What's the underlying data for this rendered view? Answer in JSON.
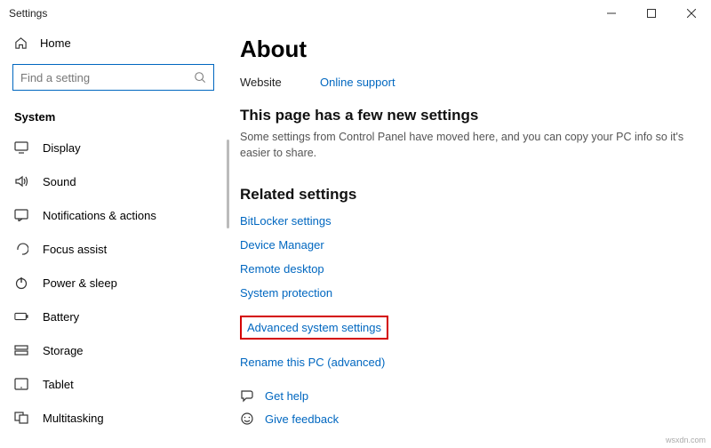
{
  "window": {
    "title": "Settings"
  },
  "sidebar": {
    "home": "Home",
    "search_placeholder": "Find a setting",
    "section": "System",
    "items": [
      {
        "label": "Display"
      },
      {
        "label": "Sound"
      },
      {
        "label": "Notifications & actions"
      },
      {
        "label": "Focus assist"
      },
      {
        "label": "Power & sleep"
      },
      {
        "label": "Battery"
      },
      {
        "label": "Storage"
      },
      {
        "label": "Tablet"
      },
      {
        "label": "Multitasking"
      }
    ]
  },
  "main": {
    "title": "About",
    "website_label": "Website",
    "website_link": "Online support",
    "new_settings_head": "This page has a few new settings",
    "new_settings_desc": "Some settings from Control Panel have moved here, and you can copy your PC info so it's easier to share.",
    "related_head": "Related settings",
    "links": {
      "bitlocker": "BitLocker settings",
      "devmgr": "Device Manager",
      "remote": "Remote desktop",
      "sysprot": "System protection",
      "advsys": "Advanced system settings",
      "rename": "Rename this PC (advanced)"
    },
    "help": {
      "gethelp": "Get help",
      "feedback": "Give feedback"
    }
  },
  "watermark": "wsxdn.com"
}
